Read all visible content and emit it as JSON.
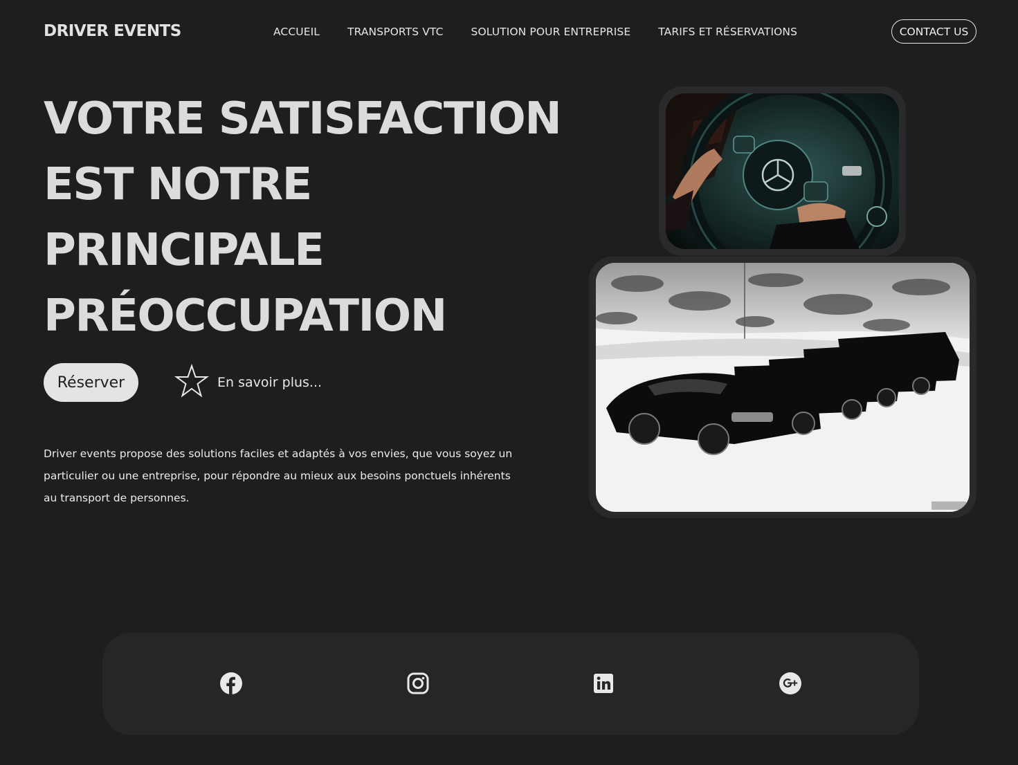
{
  "brand": {
    "logo": "DRIVER EVENTS"
  },
  "nav": {
    "items": [
      {
        "label": "ACCUEIL"
      },
      {
        "label": "TRANSPORTS VTC"
      },
      {
        "label": "SOLUTION POUR ENTREPRISE"
      },
      {
        "label": "TARIFS ET RÉSERVATIONS"
      }
    ],
    "contact_label": "CONTACT US"
  },
  "hero": {
    "title_lines": [
      "VOTRE SATISFACTION",
      "EST NOTRE",
      "PRINCIPALE",
      "PRÉOCCUPATION"
    ],
    "reserve_label": "Réserver",
    "learn_more_label": "En savoir plus...",
    "description": "Driver events propose des solutions faciles et adaptés à vos envies, que vous soyez un particulier ou une entreprise, pour répondre au mieux aux besoins ponctuels inhérents au transport de personnes."
  },
  "images": {
    "steering_wheel": {
      "icon": "steering-wheel-photo"
    },
    "car_fleet": {
      "icon": "car-fleet-photo"
    }
  },
  "footer": {
    "social": [
      {
        "icon": "facebook-icon"
      },
      {
        "icon": "instagram-icon"
      },
      {
        "icon": "linkedin-icon"
      },
      {
        "icon": "google-plus-icon"
      }
    ]
  },
  "colors": {
    "background": "#1e1e1f",
    "footer_bar": "#252628",
    "text": "#e6e6e6",
    "button_bg": "#e4e4e4"
  }
}
